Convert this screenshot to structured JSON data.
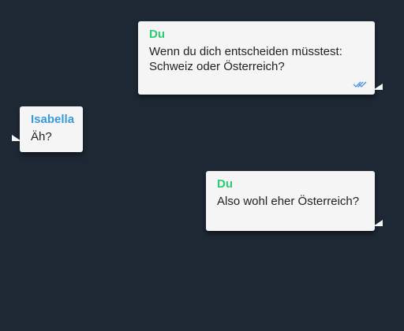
{
  "chat": {
    "messages": [
      {
        "sender": "Du",
        "text": "Wenn du dich entscheiden müsstest:\nSchweiz oder Österreich?",
        "status_icon": "double-check-icon"
      },
      {
        "sender": "Isabella",
        "text": "Äh?"
      },
      {
        "sender": "Du",
        "text": "Also wohl eher Österreich?"
      }
    ]
  },
  "colors": {
    "background": "#1e2835",
    "bubble": "#f5f5f5",
    "self_name": "#2ecc71",
    "other_name": "#3a9ad9",
    "read_ticks": "#4a90e2"
  }
}
